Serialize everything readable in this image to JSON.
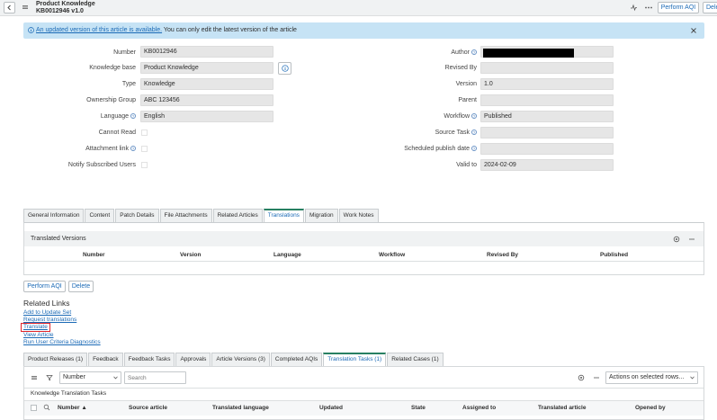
{
  "header": {
    "title": "Product Knowledge",
    "subtitle": "KB0012946 v1.0",
    "perform_aqi": "Perform AQI",
    "delete_partial": "Dele"
  },
  "banner": {
    "link_text": "An updated version of this article is available.",
    "text": "You can only edit the latest version of the article"
  },
  "form": {
    "number_label": "Number",
    "number_value": "KB0012946",
    "kb_label": "Knowledge base",
    "kb_value": "Product Knowledge",
    "type_label": "Type",
    "type_value": "Knowledge",
    "og_label": "Ownership Group",
    "og_value": "ABC 123456",
    "language_label": "Language",
    "language_value": "English",
    "cannot_read_label": "Cannot Read",
    "attachment_label": "Attachment link",
    "notify_label": "Notify Subscribed Users",
    "author_label": "Author",
    "revised_by_label": "Revised By",
    "version_label": "Version",
    "version_value": "1.0",
    "parent_label": "Parent",
    "workflow_label": "Workflow",
    "workflow_value": "Published",
    "source_task_label": "Source Task",
    "scheduled_label": "Scheduled publish date",
    "valid_to_label": "Valid to",
    "valid_to_value": "2024-02-09"
  },
  "tabs1": [
    "General Information",
    "Content",
    "Patch Details",
    "File Attachments",
    "Related Articles",
    "Translations",
    "Migration",
    "Work Notes"
  ],
  "translated": {
    "title": "Translated Versions",
    "columns": [
      "Number",
      "Version",
      "Language",
      "Workflow",
      "Revised By",
      "Published"
    ]
  },
  "actions": {
    "perform_aqi": "Perform AQI",
    "delete": "Delete"
  },
  "related_links": {
    "title": "Related Links",
    "items": [
      "Add to Update Set",
      "Request translations",
      "Translate",
      "View Article",
      "Run User Criteria Diagnostics"
    ]
  },
  "tabs2": [
    "Product Releases (1)",
    "Feedback",
    "Feedback Tasks",
    "Approvals",
    "Article Versions (3)",
    "Completed AQIs",
    "Translation Tasks (1)",
    "Related Cases (1)"
  ],
  "list": {
    "filter_field": "Number",
    "search_placeholder": "Search",
    "actions_select": "Actions on selected rows...",
    "title": "Knowledge Translation Tasks",
    "columns": [
      "Number ▲",
      "Source article",
      "Translated language",
      "Updated",
      "State",
      "Assigned to",
      "Translated article",
      "Opened by"
    ]
  },
  "colors": {
    "accent": "#278062",
    "link": "#1b6ab6",
    "banner": "#c6e3f5",
    "highlight": "#e0242b"
  }
}
